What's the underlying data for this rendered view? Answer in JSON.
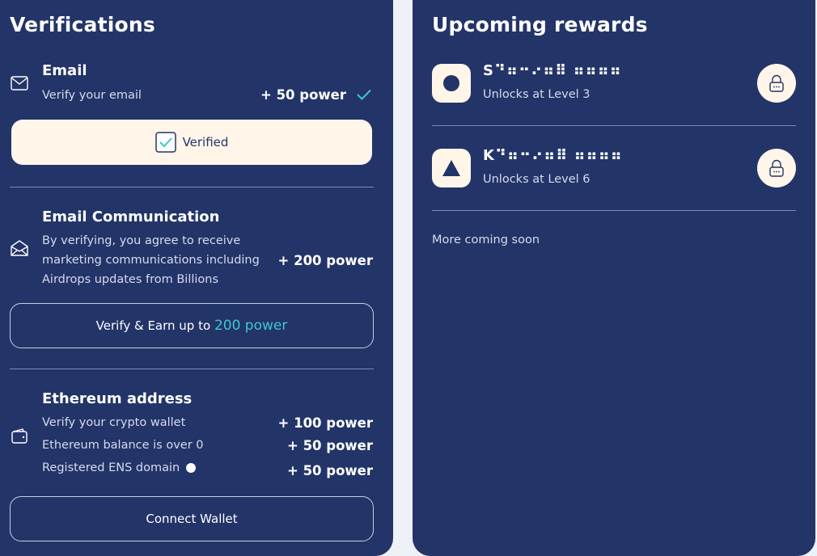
{
  "verifications": {
    "title": "Verifications",
    "email": {
      "title": "Email",
      "description": "Verify your email",
      "power": "+ 50 power",
      "status_label": "Verified"
    },
    "email_comm": {
      "title": "Email Communication",
      "description_lines": [
        "By verifying, you agree to receive",
        "marketing communications including",
        "Airdrops updates from Billions"
      ],
      "power": "+ 200 power",
      "button_label": "Verify & Earn up to",
      "button_highlight": "200 power"
    },
    "ethereum": {
      "title": "Ethereum address",
      "items": [
        {
          "label": "Verify your crypto wallet",
          "power": "+ 100 power"
        },
        {
          "label": "Ethereum balance is over 0",
          "power": "+ 50 power"
        },
        {
          "label": "Registered ENS domain",
          "power": "+ 50 power"
        }
      ],
      "button_label": "Connect Wallet"
    }
  },
  "rewards": {
    "title": "Upcoming rewards",
    "items": [
      {
        "name": "S⠙⠶⠒⠔⠶⠿ ⠶⠶⠶⠶",
        "unlock": "Unlocks at Level 3",
        "icon": "circle-icon"
      },
      {
        "name": "K⠙⠶⠒⠔⠶⠿ ⠶⠶⠶⠶",
        "unlock": "Unlocks at Level 6",
        "icon": "triangle-icon"
      }
    ],
    "more": "More coming soon"
  },
  "colors": {
    "panel": "#233468",
    "background": "#eef1f8",
    "accent": "#3ec7cf",
    "cream": "#fff6e9"
  }
}
